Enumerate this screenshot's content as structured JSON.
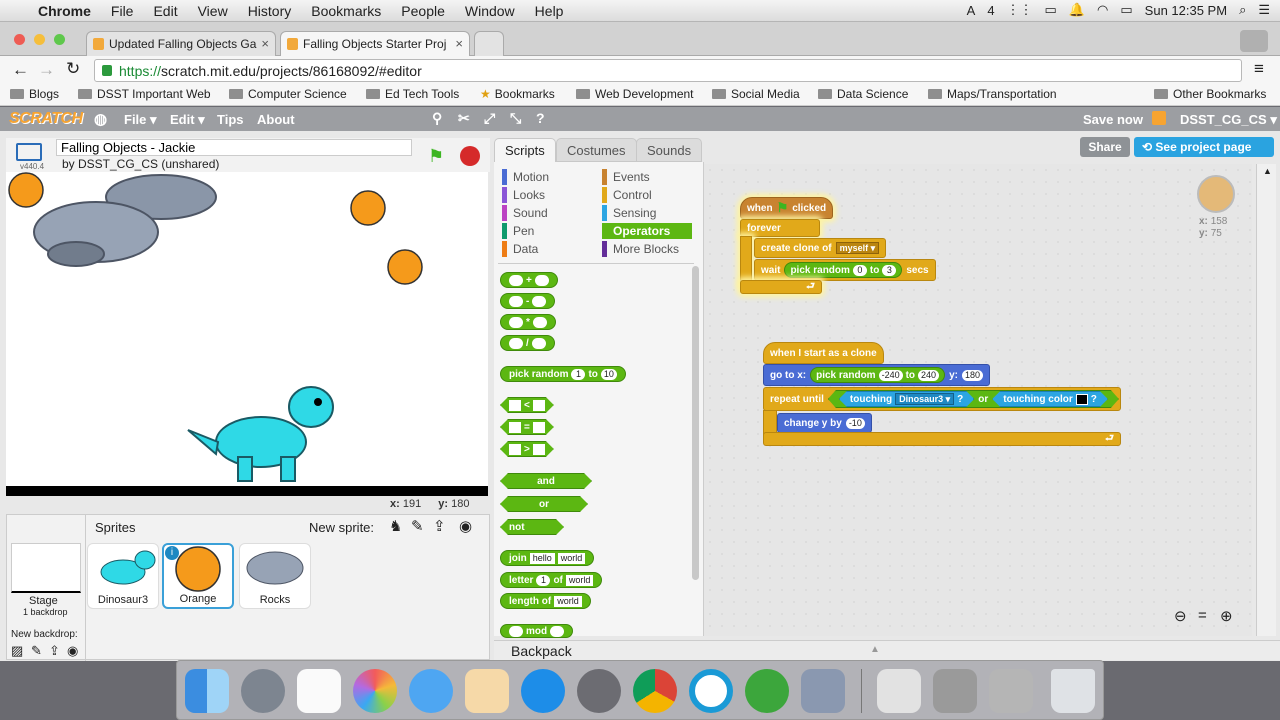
{
  "menubar": {
    "app": "Chrome",
    "items": [
      "File",
      "Edit",
      "View",
      "History",
      "Bookmarks",
      "People",
      "Window",
      "Help"
    ],
    "clock": "Sun 12:35 PM",
    "badge": "4"
  },
  "browser": {
    "tabs": [
      {
        "title": "Updated Falling Objects Ga"
      },
      {
        "title": "Falling Objects Starter Proj"
      }
    ],
    "url_scheme": "https://",
    "url_rest": "scratch.mit.edu/projects/86168092/#editor",
    "bookmarks": [
      "Blogs",
      "DSST Important Web",
      "Computer Science",
      "Ed Tech Tools",
      "Bookmarks",
      "Web Development",
      "Social Media",
      "Data Science",
      "Maps/Transportation",
      "Other Bookmarks"
    ]
  },
  "scratch_header": {
    "logo": "SCRATCH",
    "menus": [
      "File",
      "Edit",
      "Tips",
      "About"
    ],
    "save": "Save now",
    "user": "DSST_CG_CS"
  },
  "stage": {
    "title": "Falling Objects - Jackie",
    "byline": "by DSST_CG_CS (unshared)",
    "version": "v440.4",
    "x_label": "x:",
    "x": "191",
    "y_label": "y:",
    "y": "180"
  },
  "sprites_panel": {
    "title": "Sprites",
    "new_sprite": "New sprite:",
    "stage_label": "Stage",
    "backdrops": "1 backdrop",
    "new_backdrop": "New backdrop:",
    "sprites": [
      {
        "name": "Dinosaur3"
      },
      {
        "name": "Orange"
      },
      {
        "name": "Rocks"
      }
    ]
  },
  "editor_tabs": [
    "Scripts",
    "Costumes",
    "Sounds"
  ],
  "project_buttons": {
    "share": "Share",
    "see_page": "See project page"
  },
  "categories": [
    {
      "label": "Motion",
      "color": "#4a6cd4"
    },
    {
      "label": "Looks",
      "color": "#8a55d7"
    },
    {
      "label": "Sound",
      "color": "#bb42c3"
    },
    {
      "label": "Pen",
      "color": "#0e9a6c"
    },
    {
      "label": "Data",
      "color": "#ee7d16"
    },
    {
      "label": "Events",
      "color": "#c88330"
    },
    {
      "label": "Control",
      "color": "#e1a91a"
    },
    {
      "label": "Sensing",
      "color": "#2ca5e2"
    },
    {
      "label": "Operators",
      "color": "#5cb712"
    },
    {
      "label": "More Blocks",
      "color": "#632d99"
    }
  ],
  "palette_blocks": {
    "add": "+",
    "sub": "-",
    "mul": "*",
    "div": "/",
    "pick": "pick random",
    "pick_a": "1",
    "to": "to",
    "pick_b": "10",
    "lt": "<",
    "eq": "=",
    "gt": ">",
    "and": "and",
    "or": "or",
    "not": "not",
    "join": "join",
    "hello": "hello",
    "world": "world",
    "letter": "letter",
    "letter_n": "1",
    "of": "of",
    "length": "length of",
    "mod": "mod"
  },
  "script1": {
    "hat_when": "when",
    "hat_clicked": "clicked",
    "forever": "forever",
    "create": "create clone of",
    "myself": "myself",
    "wait": "wait",
    "pick": "pick random",
    "a": "0",
    "to": "to",
    "b": "3",
    "secs": "secs"
  },
  "script2": {
    "hat": "when I start as a clone",
    "goto": "go to x:",
    "pick": "pick random",
    "a": "-240",
    "to": "to",
    "b": "240",
    "y": "y:",
    "yv": "180",
    "repeat": "repeat until",
    "touching": "touching",
    "target": "Dinosaur3",
    "q": "?",
    "or": "or",
    "touching_color": "touching color",
    "change": "change y by",
    "dy": "-10"
  },
  "sprite_info": {
    "x_label": "x:",
    "x": "158",
    "y_label": "y:",
    "y": "75"
  },
  "backpack": "Backpack"
}
